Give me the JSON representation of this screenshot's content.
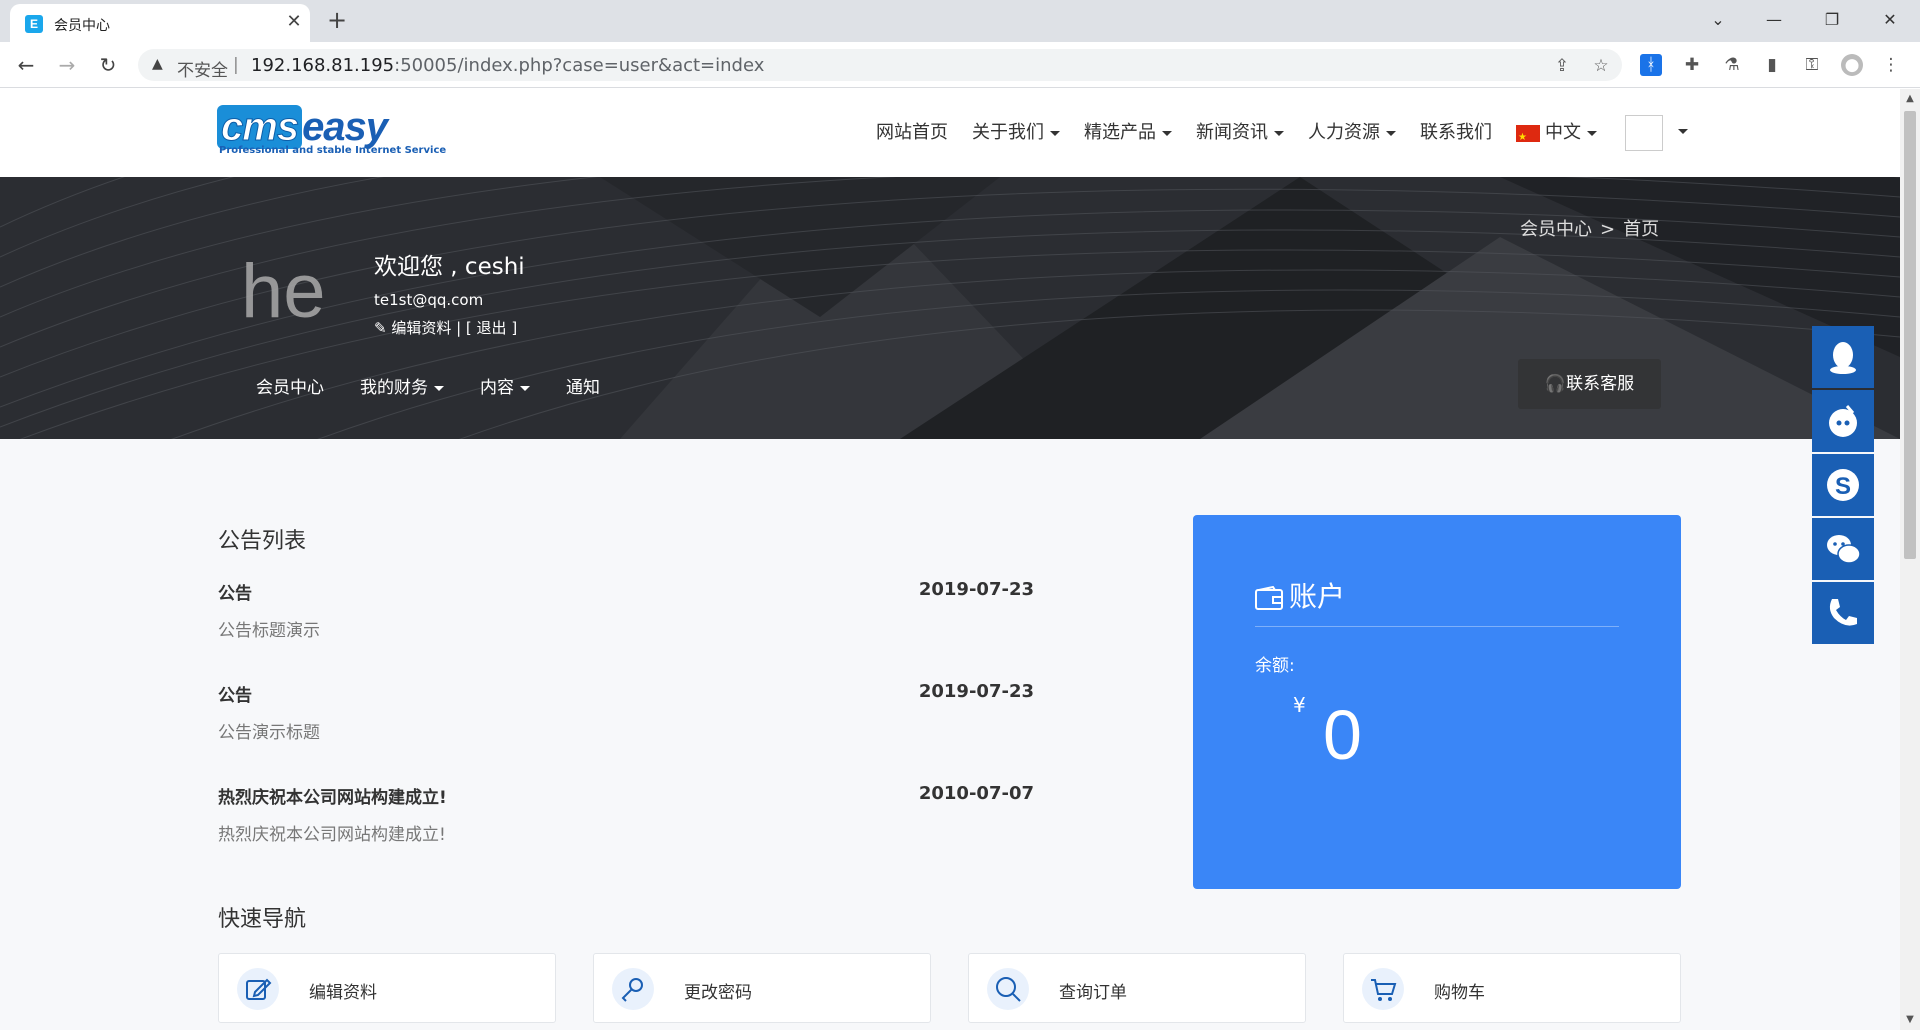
{
  "browser": {
    "tab_title": "会员中心",
    "tab_favicon_letter": "E",
    "omnibox_insecure": "不安全",
    "omnibox_sep": "|",
    "url_host": "192.168.81.195",
    "url_rest": ":50005/index.php?case=user&act=index"
  },
  "site": {
    "logo_tagline": "Professional and stable Internet Service",
    "logo_cms": "cms",
    "logo_easy": "easy",
    "nav": [
      "网站首页",
      "关于我们",
      "精选产品",
      "新闻资讯",
      "人力资源",
      "联系我们"
    ],
    "language": "中文"
  },
  "banner": {
    "breadcrumb_root": "会员中心",
    "breadcrumb_sep": ">",
    "breadcrumb_current": "首页",
    "avatar_text": "he",
    "welcome": "欢迎您 , ceshi",
    "email": "te1st@qq.com",
    "actions": "编辑资料 | [ 退出 ]",
    "subnav": [
      "会员中心",
      "我的财务",
      "内容",
      "通知"
    ],
    "service_button": "联系客服"
  },
  "notices": {
    "title": "公告列表",
    "items": [
      {
        "title": "公告",
        "date": "2019-07-23",
        "desc": "公告标题演示"
      },
      {
        "title": "公告",
        "date": "2019-07-23",
        "desc": "公告演示标题"
      },
      {
        "title": "热烈庆祝本公司网站构建成立!",
        "date": "2010-07-07",
        "desc": "热烈庆祝本公司网站构建成立!"
      }
    ]
  },
  "account": {
    "title": "账户",
    "balance_label": "余额:",
    "currency": "¥",
    "balance": "0"
  },
  "quick_nav": {
    "title": "快速导航",
    "items": [
      "编辑资料",
      "更改密码",
      "查询订单",
      "购物车"
    ]
  },
  "colors": {
    "accent": "#3a86f7",
    "float_bar": "#1a5fb4",
    "banner_bg": "#2a2c31"
  }
}
